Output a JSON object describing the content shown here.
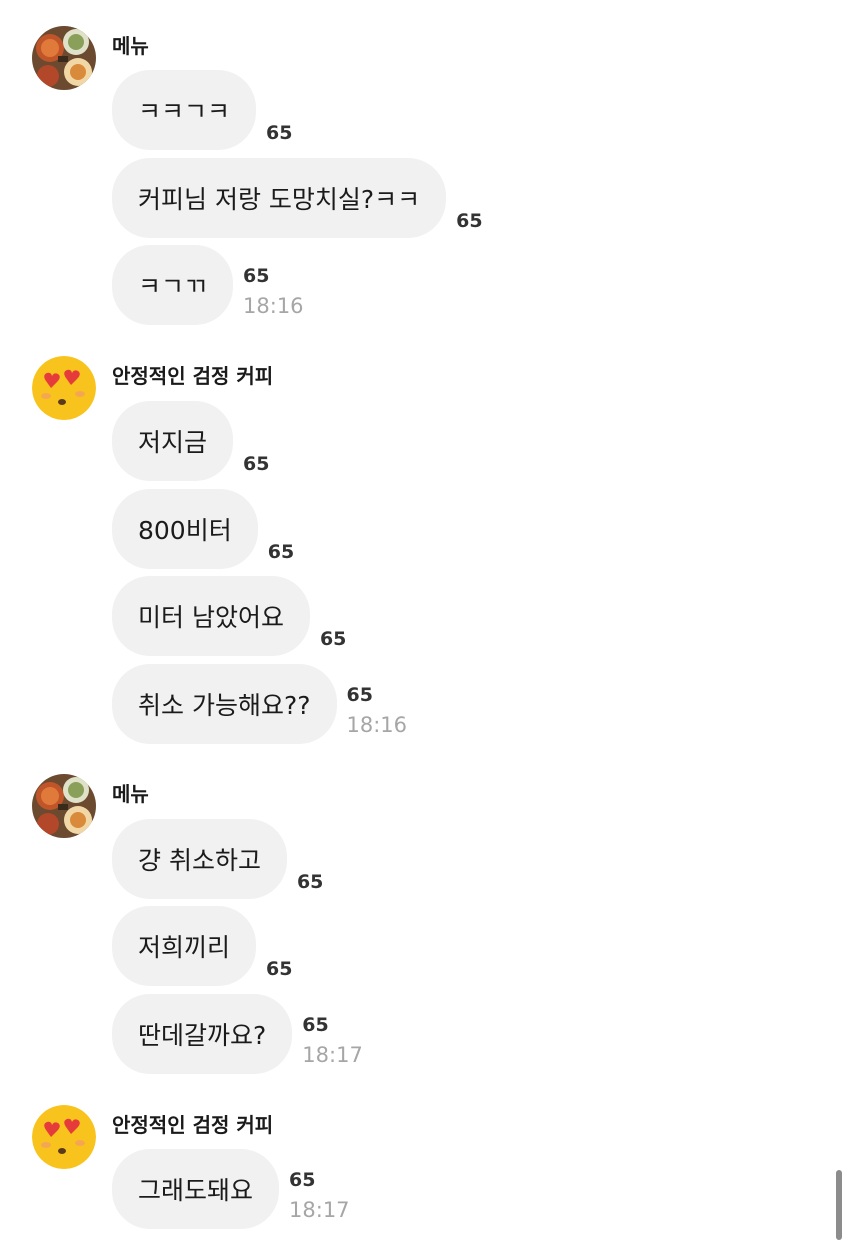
{
  "groups": [
    {
      "sender": "메뉴",
      "avatar": "food-photo-avatar",
      "messages": [
        {
          "text": "ㅋㅋㄱㅋ",
          "read": "65",
          "time": ""
        },
        {
          "text": "커피님 저랑 도망치실?ㅋㅋ",
          "read": "65",
          "time": ""
        },
        {
          "text": "ㅋㄱㄲ",
          "read": "65",
          "time": "18:16"
        }
      ]
    },
    {
      "sender": "안정적인 검정 커피",
      "avatar": "heart-eyes-emoji-avatar",
      "messages": [
        {
          "text": "저지금",
          "read": "65",
          "time": ""
        },
        {
          "text": "800비터",
          "read": "65",
          "time": ""
        },
        {
          "text": "미터 남았어요",
          "read": "65",
          "time": ""
        },
        {
          "text": "취소 가능해요??",
          "read": "65",
          "time": "18:16"
        }
      ]
    },
    {
      "sender": "메뉴",
      "avatar": "food-photo-avatar",
      "messages": [
        {
          "text": "걍 취소하고",
          "read": "65",
          "time": ""
        },
        {
          "text": "저희끼리",
          "read": "65",
          "time": ""
        },
        {
          "text": "딴데갈까요?",
          "read": "65",
          "time": "18:17"
        }
      ]
    },
    {
      "sender": "안정적인 검정 커피",
      "avatar": "heart-eyes-emoji-avatar",
      "messages": [
        {
          "text": "그래도돼요",
          "read": "65",
          "time": "18:17"
        }
      ]
    }
  ],
  "colors": {
    "bubble": "#f1f1f2",
    "read_count": "#333333",
    "timestamp": "#a6a6a6"
  }
}
